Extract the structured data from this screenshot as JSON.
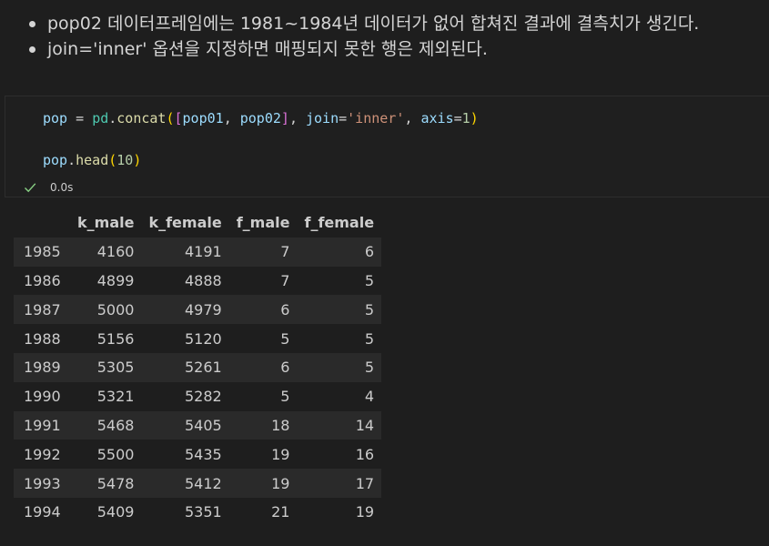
{
  "markdown": {
    "bullets": [
      "pop02 데이터프레임에는 1981~1984년 데이터가 없어 합쳐진 결과에 결측치가 생긴다.",
      "join='inner' 옵션을 지정하면 매핑되지 못한 행은 제외된다."
    ]
  },
  "code": {
    "line1": {
      "t1": "pop",
      "t2": " = ",
      "t3": "pd",
      "t4": ".",
      "t5": "concat",
      "t6": "(",
      "t7": "[",
      "t8": "pop01",
      "t9": ", ",
      "t10": "pop02",
      "t11": "]",
      "t12": ", ",
      "t13": "join",
      "t14": "=",
      "t15": "'inner'",
      "t16": ", ",
      "t17": "axis",
      "t18": "=",
      "t19": "1",
      "t20": ")"
    },
    "line2": {
      "t1": "pop",
      "t2": ".",
      "t3": "head",
      "t4": "(",
      "t5": "10",
      "t6": ")"
    },
    "status": {
      "icon": "check-icon",
      "time": "0.0s",
      "success_color": "#89d185"
    }
  },
  "table": {
    "columns": [
      "",
      "k_male",
      "k_female",
      "f_male",
      "f_female"
    ],
    "rows": [
      [
        "1985",
        "4160",
        "4191",
        "7",
        "6"
      ],
      [
        "1986",
        "4899",
        "4888",
        "7",
        "5"
      ],
      [
        "1987",
        "5000",
        "4979",
        "6",
        "5"
      ],
      [
        "1988",
        "5156",
        "5120",
        "5",
        "5"
      ],
      [
        "1989",
        "5305",
        "5261",
        "6",
        "5"
      ],
      [
        "1990",
        "5321",
        "5282",
        "5",
        "4"
      ],
      [
        "1991",
        "5468",
        "5405",
        "18",
        "14"
      ],
      [
        "1992",
        "5500",
        "5435",
        "19",
        "16"
      ],
      [
        "1993",
        "5478",
        "5412",
        "19",
        "17"
      ],
      [
        "1994",
        "5409",
        "5351",
        "21",
        "19"
      ]
    ]
  }
}
